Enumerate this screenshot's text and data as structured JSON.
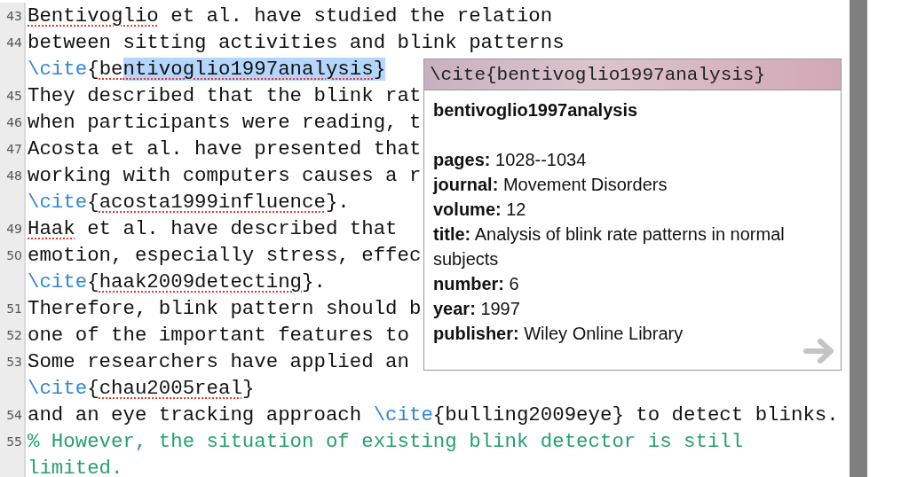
{
  "editor": {
    "lines": [
      {
        "number": "43",
        "segments": [
          {
            "kind": "text",
            "text": "Bentivoglio",
            "misspelled": true
          },
          {
            "kind": "text",
            "text": " et al. have studied the relation"
          }
        ]
      },
      {
        "number": "44",
        "segments": [
          {
            "kind": "text",
            "text": "between sitting activities and blink patterns"
          }
        ]
      },
      {
        "segments": [
          {
            "kind": "command",
            "text": "\\cite"
          },
          {
            "kind": "text",
            "text": "{"
          },
          {
            "kind": "text",
            "text": "be",
            "misspelled": true
          },
          {
            "kind": "text",
            "text": "ntivoglio1997analysis",
            "misspelled": true,
            "selected": true
          },
          {
            "kind": "text",
            "text": "}",
            "selected": true
          }
        ]
      },
      {
        "number": "45",
        "segments": [
          {
            "kind": "text",
            "text": "They described that the blink rat"
          }
        ]
      },
      {
        "number": "46",
        "segments": [
          {
            "kind": "text",
            "text": "when participants were reading, t"
          }
        ]
      },
      {
        "number": "47",
        "segments": [
          {
            "kind": "text",
            "text": "Acosta et al. have presented that"
          }
        ]
      },
      {
        "number": "48",
        "segments": [
          {
            "kind": "text",
            "text": "working with computers causes a r"
          }
        ]
      },
      {
        "segments": [
          {
            "kind": "command",
            "text": "\\cite"
          },
          {
            "kind": "text",
            "text": "{"
          },
          {
            "kind": "text",
            "text": "acosta1999influence",
            "misspelled": true
          },
          {
            "kind": "text",
            "text": "}."
          }
        ]
      },
      {
        "number": "49",
        "segments": [
          {
            "kind": "text",
            "text": "Haak",
            "misspelled": true
          },
          {
            "kind": "text",
            "text": " et al. have described that"
          }
        ]
      },
      {
        "number": "50",
        "segments": [
          {
            "kind": "text",
            "text": "emotion, especially stress, effec"
          }
        ]
      },
      {
        "segments": [
          {
            "kind": "command",
            "text": "\\cite"
          },
          {
            "kind": "text",
            "text": "{"
          },
          {
            "kind": "text",
            "text": "haak2009detecting",
            "misspelled": true
          },
          {
            "kind": "text",
            "text": "}."
          }
        ]
      },
      {
        "number": "51",
        "segments": [
          {
            "kind": "text",
            "text": "Therefore, blink pattern should b"
          }
        ]
      },
      {
        "number": "52",
        "segments": [
          {
            "kind": "text",
            "text": "one of the important features to"
          }
        ]
      },
      {
        "number": "53",
        "segments": [
          {
            "kind": "text",
            "text": "Some researchers have applied an"
          }
        ]
      },
      {
        "segments": [
          {
            "kind": "command",
            "text": "\\cite"
          },
          {
            "kind": "text",
            "text": "{"
          },
          {
            "kind": "text",
            "text": "chau2005real",
            "misspelled": true
          },
          {
            "kind": "text",
            "text": "}"
          }
        ]
      },
      {
        "number": "54",
        "segments": [
          {
            "kind": "text",
            "text": "and an eye tracking approach "
          },
          {
            "kind": "command",
            "text": "\\cite"
          },
          {
            "kind": "text",
            "text": "{bulling2009eye} to detect blinks."
          }
        ]
      },
      {
        "number": "55",
        "segments": [
          {
            "kind": "comment",
            "text": "% However, the situation of existing blink detector is still"
          }
        ]
      },
      {
        "segments": [
          {
            "kind": "comment",
            "text": "limited."
          }
        ]
      }
    ]
  },
  "popup": {
    "title": "\\cite{bentivoglio1997analysis}",
    "key": "bentivoglio1997analysis",
    "fields": [
      {
        "label": "pages:",
        "value": "1028--1034"
      },
      {
        "label": "journal:",
        "value": "Movement Disorders"
      },
      {
        "label": "volume:",
        "value": "12"
      },
      {
        "label": "title:",
        "value": "Analysis of blink rate patterns in normal subjects"
      },
      {
        "label": "number:",
        "value": "6"
      },
      {
        "label": "year:",
        "value": "1997"
      },
      {
        "label": "publisher:",
        "value": "Wiley Online Library"
      }
    ]
  }
}
